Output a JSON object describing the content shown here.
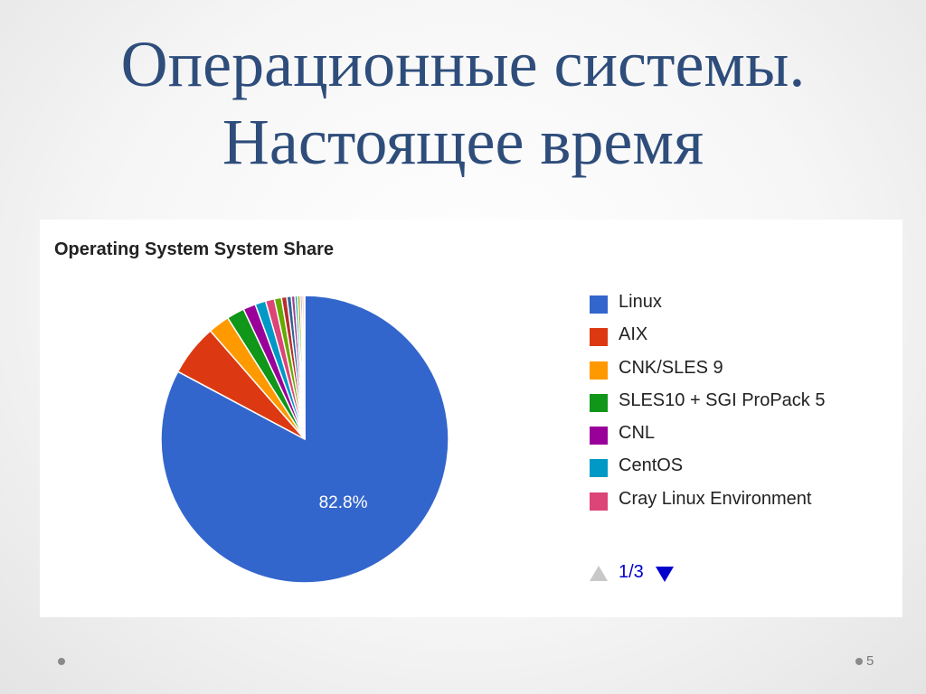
{
  "slide": {
    "title_line1": "Операционные системы.",
    "title_line2": "Настоящее время",
    "page_number": "5"
  },
  "chart_data": {
    "type": "pie",
    "title": "Operating System System Share",
    "start_angle_deg": 0,
    "direction": "clockwise",
    "data_labels": [
      "82.8%"
    ],
    "slices": [
      {
        "label": "Linux",
        "value": 82.8,
        "color": "#3366cc"
      },
      {
        "label": "AIX",
        "value": 5.8,
        "color": "#dc3912"
      },
      {
        "label": "CNK/SLES 9",
        "value": 2.4,
        "color": "#ff9900"
      },
      {
        "label": "SLES10 + SGI ProPack 5",
        "value": 2.0,
        "color": "#109618"
      },
      {
        "label": "CNL",
        "value": 1.4,
        "color": "#990099"
      },
      {
        "label": "CentOS",
        "value": 1.2,
        "color": "#0099c6"
      },
      {
        "label": "Cray Linux Environment",
        "value": 1.0,
        "color": "#dd4477"
      },
      {
        "label": "",
        "value": 0.8,
        "color": "#66aa00"
      },
      {
        "label": "",
        "value": 0.6,
        "color": "#b82e2e"
      },
      {
        "label": "",
        "value": 0.5,
        "color": "#316395"
      },
      {
        "label": "",
        "value": 0.4,
        "color": "#994499"
      },
      {
        "label": "",
        "value": 0.3,
        "color": "#22aa99"
      },
      {
        "label": "",
        "value": 0.3,
        "color": "#aaaa11"
      },
      {
        "label": "",
        "value": 0.2,
        "color": "#6633cc"
      },
      {
        "label": "",
        "value": 0.2,
        "color": "#e67300"
      },
      {
        "label": "",
        "value": 0.1,
        "color": "#8b0707"
      }
    ],
    "legend": {
      "position": "right",
      "visible_items": [
        "Linux",
        "AIX",
        "CNK/SLES 9",
        "SLES10 + SGI ProPack 5",
        "CNL",
        "CentOS",
        "Cray Linux Environment"
      ],
      "pager_text": "1/3",
      "inactive_color": "#c8c8c8",
      "active_color": "#0000cc"
    }
  }
}
